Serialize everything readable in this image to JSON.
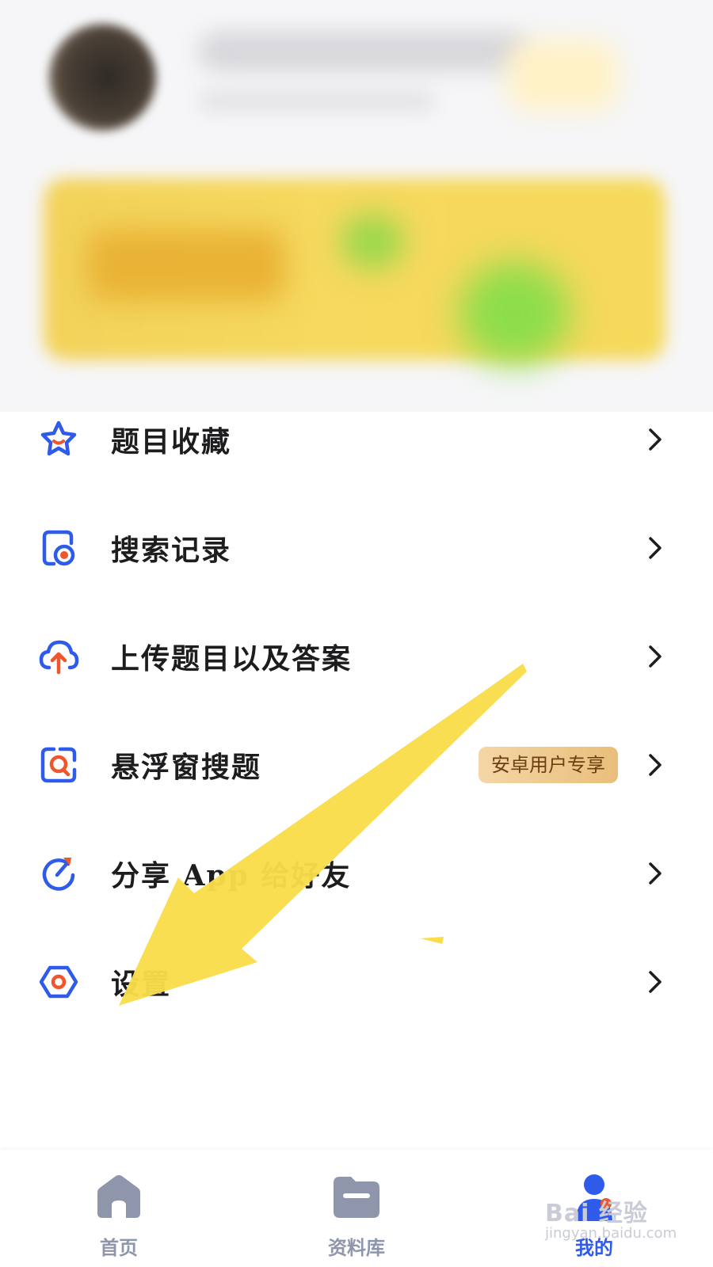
{
  "menu": {
    "items": [
      {
        "label": "题目收藏",
        "icon": "star-icon"
      },
      {
        "label": "搜索记录",
        "icon": "search-history-icon"
      },
      {
        "label": "上传题目以及答案",
        "icon": "cloud-upload-icon"
      },
      {
        "label": "悬浮窗搜题",
        "icon": "floating-window-search-icon",
        "badge": "安卓用户专享"
      },
      {
        "label": "分享 App 给好友",
        "icon": "share-icon"
      },
      {
        "label": "设置",
        "icon": "settings-icon"
      }
    ]
  },
  "bottom_nav": {
    "items": [
      {
        "label": "首页",
        "icon": "home-icon",
        "active": false
      },
      {
        "label": "资料库",
        "icon": "folder-icon",
        "active": false
      },
      {
        "label": "我的",
        "icon": "profile-icon",
        "active": true
      }
    ]
  },
  "watermark": {
    "main": "Bai 经验",
    "sub": "jingyan.baidu.com"
  },
  "colors": {
    "primary_blue": "#2f5bea",
    "accent_orange": "#f0562c",
    "badge_text": "#6b3f12",
    "nav_inactive": "#8f95aa",
    "arrow_yellow": "#f9dd4b"
  }
}
